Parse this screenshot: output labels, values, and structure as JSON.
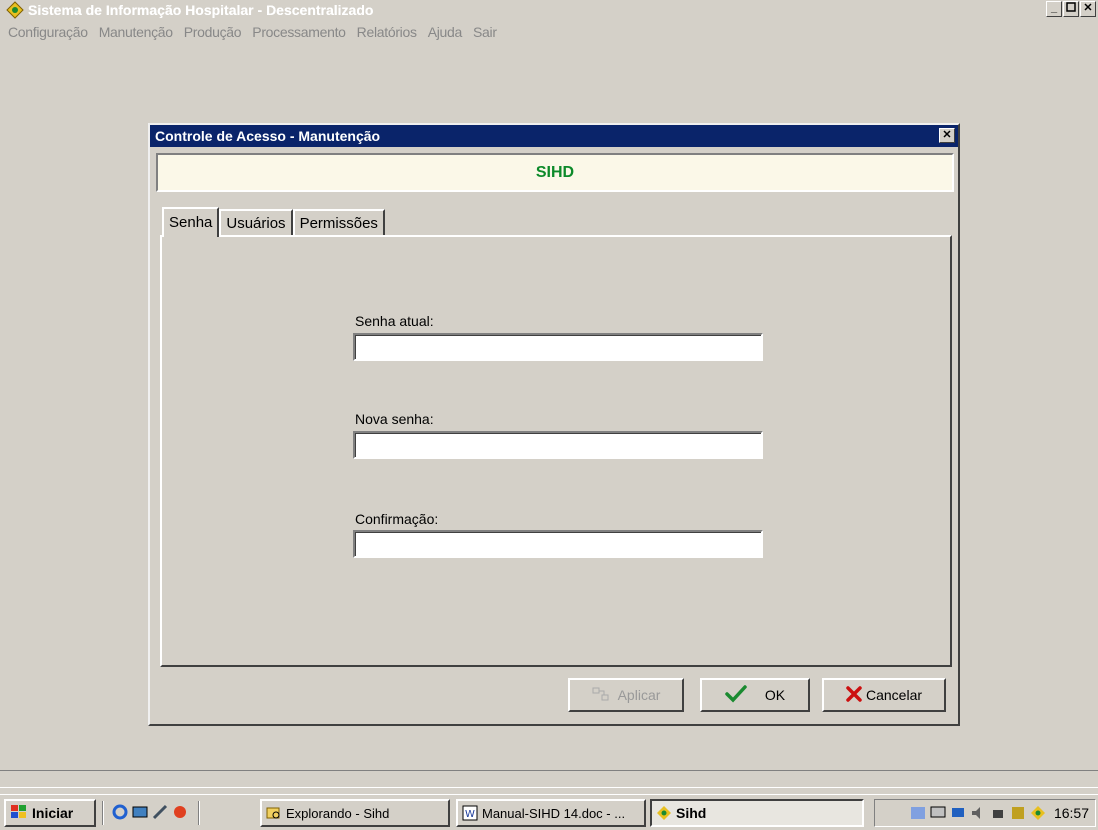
{
  "app": {
    "title": "Sistema de Informação Hospitalar - Descentralizado",
    "window_buttons": [
      "_",
      "8",
      "X"
    ]
  },
  "menu": {
    "items": [
      "Configuração",
      "Manutenção",
      "Produção",
      "Processamento",
      "Relatórios",
      "Ajuda",
      "Sair"
    ]
  },
  "dialog": {
    "title": "Controle de Acesso - Manutenção",
    "close": "X",
    "header": "SIHD",
    "tabs": [
      "Senha",
      "Usuários",
      "Permissões"
    ],
    "fields": {
      "current_password_label": "Senha atual:",
      "new_password_label": "Nova senha:",
      "confirmation_label": "Confirmação:",
      "current_password_value": "",
      "new_password_value": "",
      "confirmation_value": ""
    },
    "buttons": {
      "apply": "Aplicar",
      "ok": "OK",
      "cancel": "Cancelar"
    }
  },
  "taskbar": {
    "start": "Iniciar",
    "tasks": [
      "Explorando - Sihd",
      "Manual-SIHD 14.doc - ...",
      "Sihd"
    ],
    "clock": "16:57"
  },
  "colors": {
    "dialog_title_bg": "#0a246a",
    "header_bg": "#fbf8e8",
    "header_text": "#0c8a2a",
    "window_bg": "#d4d0c8"
  }
}
